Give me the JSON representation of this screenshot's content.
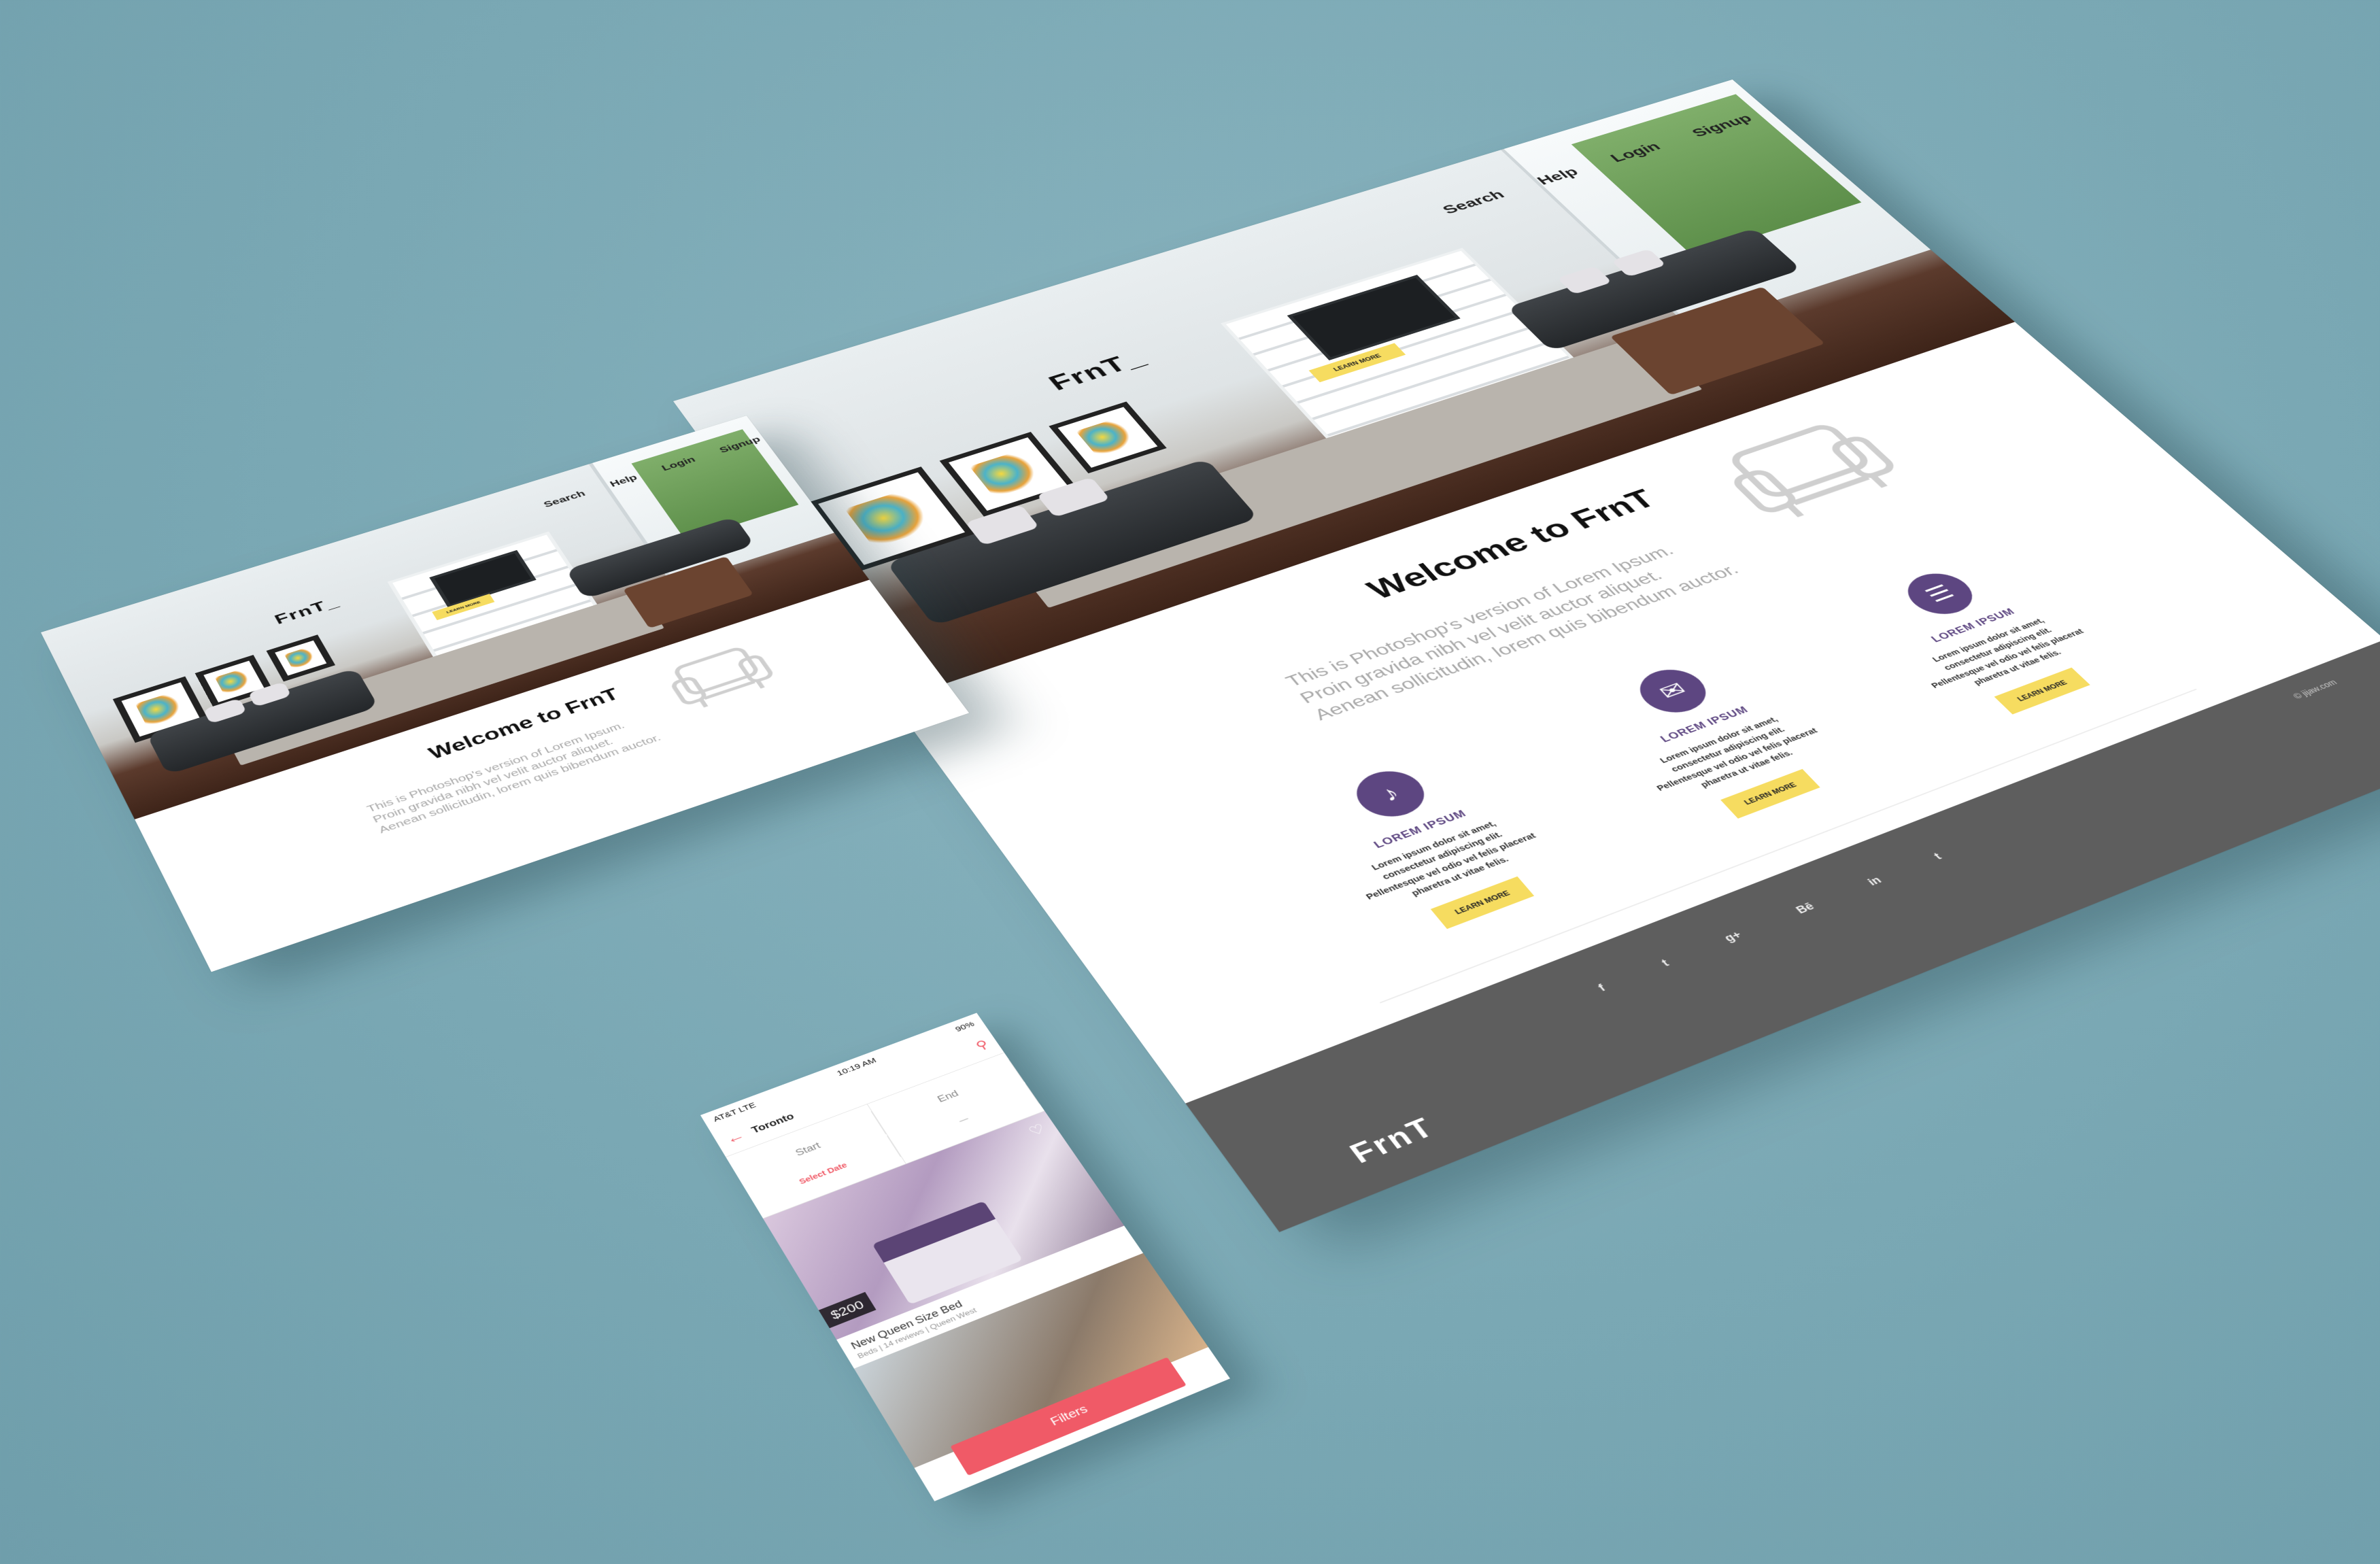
{
  "colors": {
    "background": "#7aa8b4",
    "accent_yellow": "#f6dc60",
    "accent_purple": "#5d4681",
    "footer_gray": "#5e5e5e",
    "phone_red": "#f05a67"
  },
  "large": {
    "logo": "FrnT_",
    "nav": [
      "Search",
      "Help",
      "Login",
      "Signup"
    ],
    "hero_button": "LEARN MORE",
    "welcome": "Welcome to FrnT",
    "intro": "This is Photoshop's version of Lorem Ipsum. Proin gravida nibh vel velit auctor aliquet. Aenean sollicitudin, lorem quis bibendum auctor.",
    "features": [
      {
        "icon": "bell-icon",
        "title": "LOREM IPSUM",
        "text": "Lorem ipsum dolor sit amet, consectetur adipiscing elit. Pellentesque vel odio vel felis placerat pharetra ut vitae felis.",
        "button": "LEARN MORE"
      },
      {
        "icon": "mail-icon",
        "title": "LOREM IPSUM",
        "text": "Lorem ipsum dolor sit amet, consectetur adipiscing elit. Pellentesque vel odio vel felis placerat pharetra ut vitae felis.",
        "button": "LEARN MORE"
      },
      {
        "icon": "chat-icon",
        "title": "LOREM IPSUM",
        "text": "Lorem ipsum dolor sit amet, consectetur adipiscing elit. Pellentesque vel odio vel felis placerat pharetra ut vitae felis.",
        "button": "LEARN MORE"
      }
    ],
    "footer_logo": "FrnT",
    "copyright": "© jijaw.com",
    "socials": [
      "f",
      "t",
      "g+",
      "Bē",
      "in",
      "t"
    ]
  },
  "small": {
    "logo": "FrnT_",
    "nav": [
      "Search",
      "Help",
      "Login",
      "Signup"
    ],
    "hero_button": "LEARN MORE",
    "welcome": "Welcome to FrnT",
    "intro": "This is Photoshop's version of Lorem Ipsum. Proin gravida nibh vel velit auctor aliquet. Aenean sollicitudin, lorem quis bibendum auctor."
  },
  "phone": {
    "carrier": "AT&T  LTE",
    "time": "10:19 AM",
    "battery": "90%",
    "city": "Toronto",
    "start_label": "Start",
    "start_sub": "Select Date",
    "end_label": "End",
    "end_sub": "—",
    "price": "$200",
    "listing_title": "New Queen Size Bed",
    "listing_meta": "Beds  |  14 reviews  |  Queen West",
    "filters": "Filters"
  }
}
